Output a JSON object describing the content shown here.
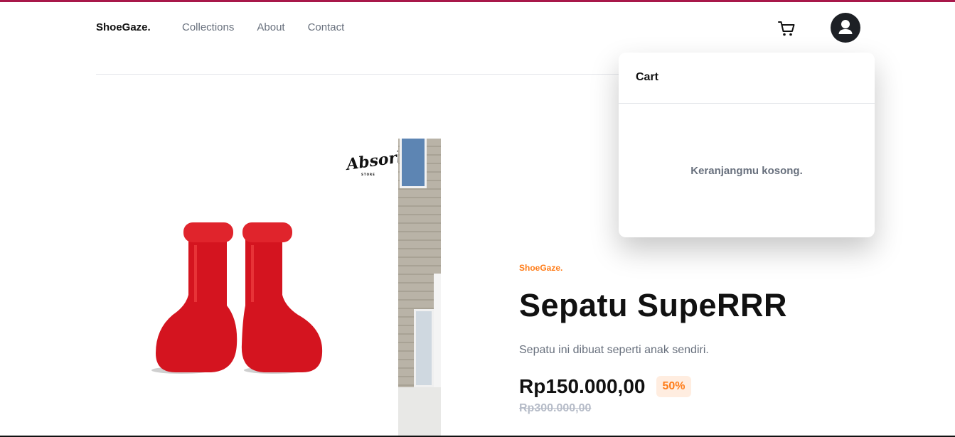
{
  "header": {
    "logo": "ShoeGaze.",
    "nav": [
      "Collections",
      "About",
      "Contact"
    ],
    "cart_icon": "cart-icon",
    "avatar_icon": "user-icon"
  },
  "product": {
    "image_brand": "Absorb",
    "image_brand_sub": "STORE",
    "company": "ShoeGaze.",
    "title": "Sepatu SupeRRR",
    "description": "Sepatu ini dibuat seperti anak sendiri.",
    "price": "Rp150.000,00",
    "discount": "50%",
    "old_price": "Rp300.000,00"
  },
  "cart": {
    "title": "Cart",
    "empty_message": "Keranjangmu kosong."
  },
  "colors": {
    "accent": "#ff7d1a",
    "accent_bg": "#ffede0",
    "top_bar": "#a8184a",
    "boot_red": "#d4141f"
  }
}
